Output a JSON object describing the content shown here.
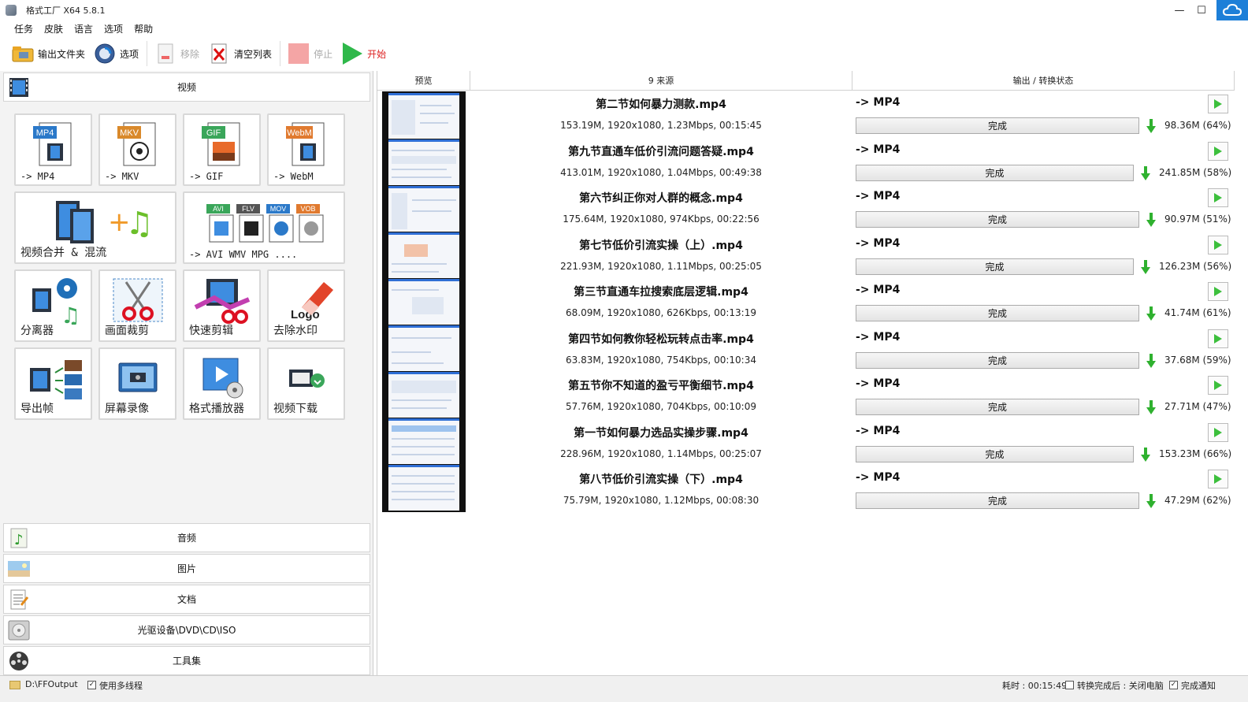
{
  "window": {
    "title": "格式工厂 X64 5.8.1",
    "minimize": "—",
    "maximize": "☐"
  },
  "menu": [
    "任务",
    "皮肤",
    "语言",
    "选项",
    "帮助"
  ],
  "toolbar": {
    "output_folder": "输出文件夹",
    "options": "选项",
    "remove": "移除",
    "clear_list": "清空列表",
    "stop": "停止",
    "start": "开始"
  },
  "left": {
    "categories": {
      "video": "视频",
      "audio": "音频",
      "image": "图片",
      "document": "文档",
      "disc": "光驱设备\\DVD\\CD\\ISO",
      "tools": "工具集"
    },
    "tiles": [
      {
        "label": "-> MP4",
        "badge": "MP4",
        "badge_color": "#2b79c9"
      },
      {
        "label": "-> MKV",
        "badge": "MKV",
        "badge_color": "#d9892b"
      },
      {
        "label": "-> GIF",
        "badge": "GIF",
        "badge_color": "#3aa65a"
      },
      {
        "label": "-> WebM",
        "badge": "WebM",
        "badge_color": "#e07a2f"
      },
      {
        "label": "视频合并 & 混流"
      },
      {
        "label": "-> AVI WMV MPG ....",
        "badges": [
          "AVI",
          "FLV",
          "MOV",
          "VOB"
        ]
      },
      {
        "label": "分离器"
      },
      {
        "label": "画面裁剪"
      },
      {
        "label": "快速剪辑"
      },
      {
        "label": "去除水印",
        "logo_text": "Logo"
      },
      {
        "label": "导出帧"
      },
      {
        "label": "屏幕录像"
      },
      {
        "label": "格式播放器"
      },
      {
        "label": "视频下载"
      }
    ]
  },
  "right": {
    "headers": {
      "preview": "预览",
      "source": "9 来源",
      "output": "输出 / 转换状态"
    },
    "rows": [
      {
        "name": "第二节如何暴力测款.mp4",
        "info": "153.19M, 1920x1080, 1.23Mbps, 00:15:45",
        "fmt": "-> MP4",
        "status": "完成",
        "size": "98.36M",
        "pct": "(64%)"
      },
      {
        "name": "第九节直通车低价引流问题答疑.mp4",
        "info": "413.01M, 1920x1080, 1.04Mbps, 00:49:38",
        "fmt": "-> MP4",
        "status": "完成",
        "size": "241.85M",
        "pct": "(58%)"
      },
      {
        "name": "第六节纠正你对人群的概念.mp4",
        "info": "175.64M, 1920x1080, 974Kbps, 00:22:56",
        "fmt": "-> MP4",
        "status": "完成",
        "size": "90.97M",
        "pct": "(51%)"
      },
      {
        "name": "第七节低价引流实操（上）.mp4",
        "info": "221.93M, 1920x1080, 1.11Mbps, 00:25:05",
        "fmt": "-> MP4",
        "status": "完成",
        "size": "126.23M",
        "pct": "(56%)"
      },
      {
        "name": "第三节直通车拉搜索底层逻辑.mp4",
        "info": "68.09M, 1920x1080, 626Kbps, 00:13:19",
        "fmt": "-> MP4",
        "status": "完成",
        "size": "41.74M",
        "pct": "(61%)"
      },
      {
        "name": "第四节如何教你轻松玩转点击率.mp4",
        "info": "63.83M, 1920x1080, 754Kbps, 00:10:34",
        "fmt": "-> MP4",
        "status": "完成",
        "size": "37.68M",
        "pct": "(59%)"
      },
      {
        "name": "第五节你不知道的盈亏平衡细节.mp4",
        "info": "57.76M, 1920x1080, 704Kbps, 00:10:09",
        "fmt": "-> MP4",
        "status": "完成",
        "size": "27.71M",
        "pct": "(47%)"
      },
      {
        "name": "第一节如何暴力选品实操步骤.mp4",
        "info": "228.96M, 1920x1080, 1.14Mbps, 00:25:07",
        "fmt": "-> MP4",
        "status": "完成",
        "size": "153.23M",
        "pct": "(66%)"
      },
      {
        "name": "第八节低价引流实操（下）.mp4",
        "info": "75.79M, 1920x1080, 1.12Mbps, 00:08:30",
        "fmt": "-> MP4",
        "status": "完成",
        "size": "47.29M",
        "pct": "(62%)"
      }
    ]
  },
  "statusbar": {
    "output_path": "D:\\FFOutput",
    "multithread": "使用多线程",
    "elapsed": "耗时 : 00:15:49",
    "after_convert": "转换完成后 : 关闭电脑",
    "notify": "完成通知"
  },
  "colors": {
    "accent_blue": "#1d7fd8",
    "play_green": "#3cbf3c",
    "down_green": "#2fb12f"
  }
}
